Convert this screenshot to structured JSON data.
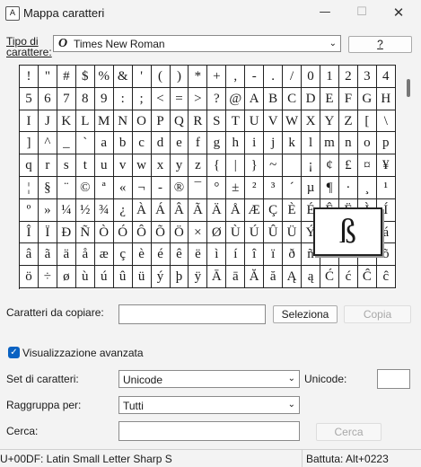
{
  "window": {
    "title": "Mappa caratteri",
    "icon": "charmap-app-icon"
  },
  "font": {
    "label": "Tipo di carattere:",
    "value": "Times New Roman",
    "help_label": "?"
  },
  "grid": {
    "rows": [
      [
        "!",
        "\"",
        "#",
        "$",
        "%",
        "&",
        "'",
        "(",
        ")",
        "*",
        "+",
        ",",
        "-",
        ".",
        "/",
        "0",
        "1",
        "2",
        "3",
        "4"
      ],
      [
        "5",
        "6",
        "7",
        "8",
        "9",
        ":",
        ";",
        "<",
        "=",
        ">",
        "?",
        "@",
        "A",
        "B",
        "C",
        "D",
        "E",
        "F",
        "G",
        "H"
      ],
      [
        "I",
        "J",
        "K",
        "L",
        "M",
        "N",
        "O",
        "P",
        "Q",
        "R",
        "S",
        "T",
        "U",
        "V",
        "W",
        "X",
        "Y",
        "Z",
        "[",
        "\\"
      ],
      [
        "]",
        "^",
        "_",
        "`",
        "a",
        "b",
        "c",
        "d",
        "e",
        "f",
        "g",
        "h",
        "i",
        "j",
        "k",
        "l",
        "m",
        "n",
        "o",
        "p"
      ],
      [
        "q",
        "r",
        "s",
        "t",
        "u",
        "v",
        "w",
        "x",
        "y",
        "z",
        "{",
        "|",
        "}",
        "~",
        " ",
        "¡",
        "¢",
        "£",
        "¤",
        "¥"
      ],
      [
        "¦",
        "§",
        "¨",
        "©",
        "ª",
        "«",
        "¬",
        "-",
        "®",
        "¯",
        "°",
        "±",
        "²",
        "³",
        "´",
        "µ",
        "¶",
        "·",
        "¸",
        "¹"
      ],
      [
        "º",
        "»",
        "¼",
        "½",
        "¾",
        "¿",
        "À",
        "Á",
        "Â",
        "Ã",
        "Ä",
        "Å",
        "Æ",
        "Ç",
        "È",
        "É",
        "Ê",
        "Ë",
        "Ì",
        "Í"
      ],
      [
        "Î",
        "Ï",
        "Ð",
        "Ñ",
        "Ò",
        "Ó",
        "Ô",
        "Õ",
        "Ö",
        "×",
        "Ø",
        "Ù",
        "Ú",
        "Û",
        "Ü",
        "Ý",
        "Þ",
        "ß",
        "à",
        "á"
      ],
      [
        "â",
        "ã",
        "ä",
        "å",
        "æ",
        "ç",
        "è",
        "é",
        "ê",
        "ë",
        "ì",
        "í",
        "î",
        "ï",
        "ð",
        "ñ",
        "ò",
        "ó",
        "ô",
        "õ"
      ],
      [
        "ö",
        "÷",
        "ø",
        "ù",
        "ú",
        "û",
        "ü",
        "ý",
        "þ",
        "ÿ",
        "Ā",
        "ā",
        "Ă",
        "ă",
        "Ą",
        "ą",
        "Ć",
        "ć",
        "Ĉ",
        "ĉ"
      ]
    ],
    "selected_char": "ß"
  },
  "copy": {
    "label": "Caratteri da copiare:",
    "value": "",
    "select_label": "Seleziona",
    "copy_label": "Copia"
  },
  "advanced": {
    "label": "Visualizzazione avanzata",
    "checked": true
  },
  "charset": {
    "label": "Set di caratteri:",
    "value": "Unicode"
  },
  "unicode": {
    "label": "Unicode:",
    "value": ""
  },
  "group": {
    "label": "Raggruppa per:",
    "value": "Tutti"
  },
  "search": {
    "label": "Cerca:",
    "value": "",
    "button_label": "Cerca"
  },
  "status": {
    "char_info": "U+00DF: Latin Small Letter Sharp S",
    "keystroke": "Battuta: Alt+0223"
  },
  "colors": {
    "accent": "#0a62c2",
    "disabled_text": "#a8a8a8",
    "grid_line": "#222222"
  }
}
